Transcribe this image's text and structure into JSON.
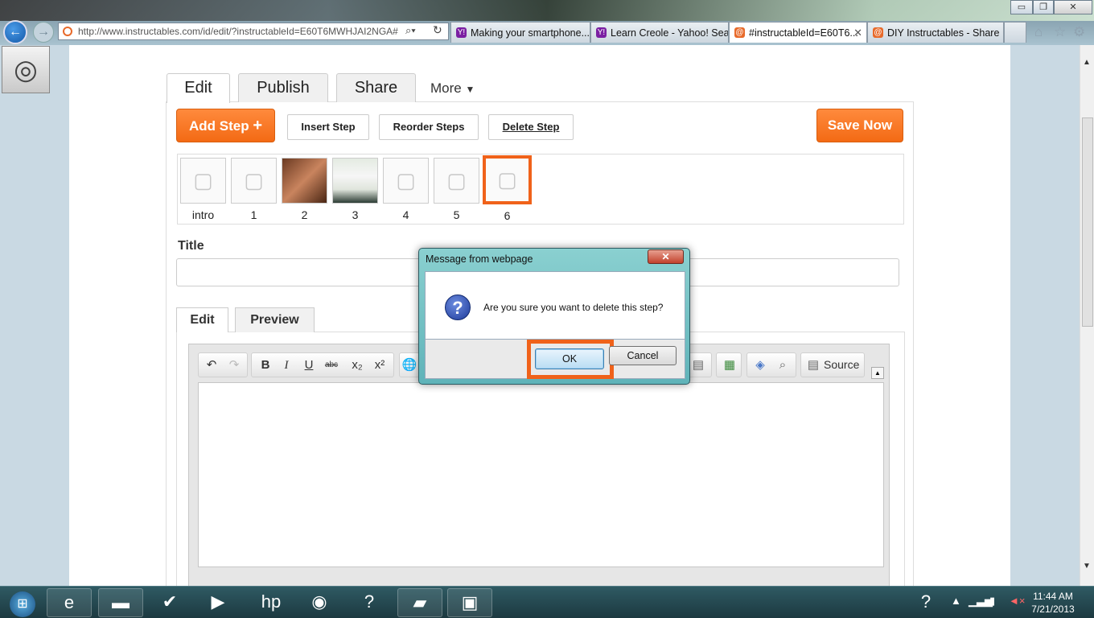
{
  "browser": {
    "address": "http://www.instructables.com/id/edit/?instructableId=E60T6MWHJAI2NGA#",
    "tabs": [
      {
        "label": "Making your smartphone...",
        "icon": "Y!",
        "color": "#7b1fa2"
      },
      {
        "label": "Learn Creole - Yahoo! Sea...",
        "icon": "Y!",
        "color": "#7b1fa2"
      },
      {
        "label": "#instructableId=E60T6...",
        "icon": "@",
        "color": "#e86a2a",
        "active": true
      },
      {
        "label": "DIY Instructables - Share ...",
        "icon": "@",
        "color": "#e86a2a"
      }
    ],
    "window_buttons": {
      "minimize": "▭",
      "restore": "❐",
      "close": "✕"
    },
    "toolbar_icons": [
      "home-icon",
      "star-icon",
      "gear-icon"
    ]
  },
  "editor": {
    "tabs": [
      "Edit",
      "Publish",
      "Share",
      "More"
    ],
    "add_step": "Add Step",
    "insert_step": "Insert Step",
    "reorder_steps": "Reorder Steps",
    "delete_step": "Delete Step",
    "save_now": "Save Now",
    "steps": [
      "intro",
      "1",
      "2",
      "3",
      "4",
      "5",
      "6"
    ],
    "title_label": "Title",
    "subtabs": [
      "Edit",
      "Preview"
    ],
    "source_label": "Source"
  },
  "dialog": {
    "title": "Message from webpage",
    "message": "Are you sure you want to delete this step?",
    "ok": "OK",
    "cancel": "Cancel"
  },
  "taskbar": {
    "time": "11:44 AM",
    "date": "7/21/2013"
  },
  "colors": {
    "accent": "#f0621a",
    "page_bg": "#c9d9e3"
  }
}
